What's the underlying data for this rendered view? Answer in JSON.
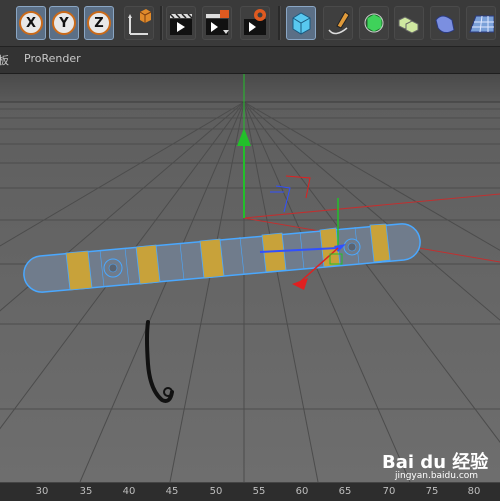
{
  "toolbar": {
    "x_label": "X",
    "y_label": "Y",
    "z_label": "Z",
    "icons": [
      "x-axis-lock-icon",
      "y-axis-lock-icon",
      "z-axis-lock-icon",
      "world-coordinate-icon",
      "render-view-icon",
      "render-to-picture-viewer-icon",
      "render-settings-icon",
      "cube-primitive-icon",
      "pen-spline-icon",
      "subdivision-surface-icon",
      "array-icon",
      "deformer-icon",
      "floor-icon"
    ]
  },
  "menubar": {
    "partial_label": "板",
    "prorender_label": "ProRender"
  },
  "ruler": {
    "ticks": [
      "30",
      "35",
      "40",
      "45",
      "50",
      "55",
      "60",
      "65",
      "70",
      "75",
      "80"
    ]
  },
  "watermark": {
    "brand": "Bai du 经验",
    "url": "jingyan.baidu.com"
  },
  "colors": {
    "accent_selected": "#5b6f86",
    "object_outline": "#4aa8ff",
    "highlight_segments": "#c8a23a",
    "axis_y": "#22c02a",
    "axis_x": "#e02020",
    "axis_z": "#3050ff"
  }
}
